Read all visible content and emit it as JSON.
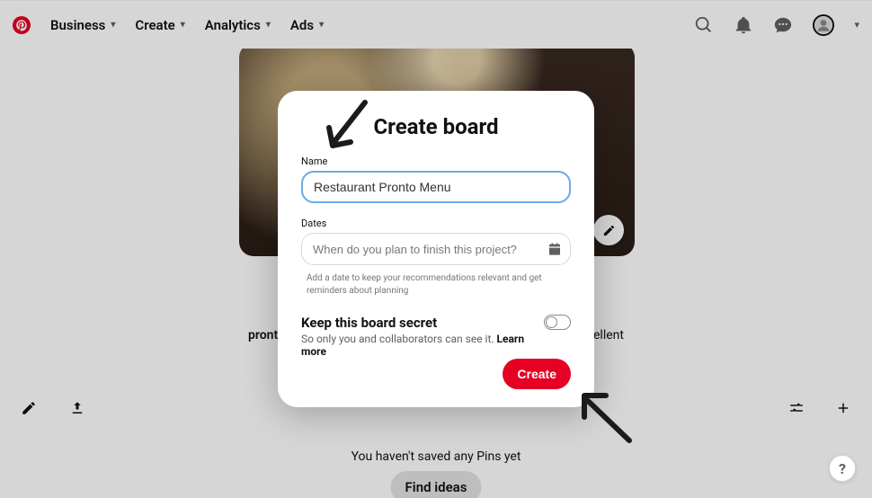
{
  "header": {
    "nav": {
      "business": "Business",
      "create": "Create",
      "analytics": "Analytics",
      "ads": "Ads"
    }
  },
  "background": {
    "caption_left": "pront",
    "caption_right": "ellent",
    "no_pins": "You haven't saved any Pins yet",
    "find_ideas": "Find ideas"
  },
  "modal": {
    "title": "Create board",
    "name_label": "Name",
    "name_value": "Restaurant Pronto Menu",
    "dates_label": "Dates",
    "dates_placeholder": "When do you plan to finish this project?",
    "dates_hint": "Add a date to keep your recommendations relevant and get reminders about planning",
    "secret_title": "Keep this board secret",
    "secret_sub_prefix": "So only you and collaborators can see it. ",
    "secret_learn": "Learn more",
    "create": "Create"
  },
  "help": "?"
}
